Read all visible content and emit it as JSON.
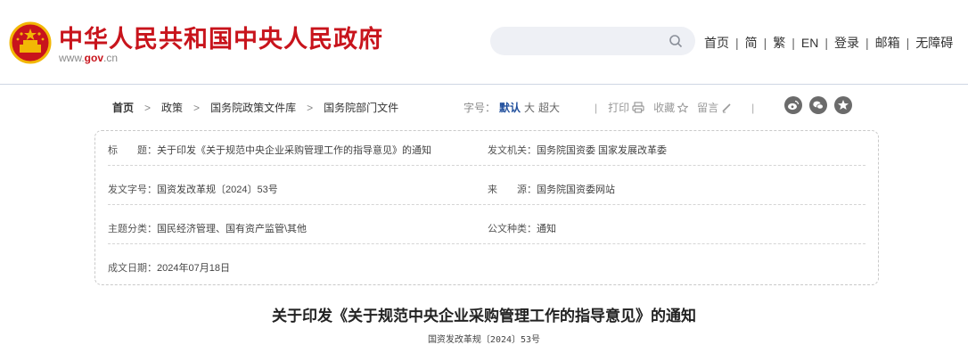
{
  "header": {
    "title": "中华人民共和国中央人民政府",
    "url_prefix": "www.",
    "url_gov": "gov",
    "url_suffix": ".cn",
    "search": {
      "placeholder": ""
    },
    "nav": [
      "首页",
      "简",
      "繁",
      "EN",
      "登录",
      "邮箱",
      "无障碍"
    ]
  },
  "breadcrumb": {
    "items": [
      "首页",
      "政策",
      "国务院政策文件库",
      "国务院部门文件"
    ],
    "separator": ">"
  },
  "font_size": {
    "label": "字号：",
    "options": [
      "默认",
      "大",
      "超大"
    ],
    "selected": "默认"
  },
  "tools": {
    "divider": "|",
    "print": "打印",
    "favorite": "收藏",
    "comment": "留言"
  },
  "info": {
    "title_label": "标　　题：",
    "title_value": "关于印发《关于规范中央企业采购管理工作的指导意见》的通知",
    "issuer_label": "发文机关：",
    "issuer_value": "国务院国资委  国家发展改革委",
    "doc_no_label": "发文字号：",
    "doc_no_value": "国资发改革规〔2024〕53号",
    "source_label": "来　　源：",
    "source_value": "国务院国资委网站",
    "topic_label": "主题分类：",
    "topic_value": "国民经济管理、国有资产监管\\其他",
    "type_label": "公文种类：",
    "type_value": "通知",
    "date_label": "成文日期：",
    "date_value": "2024年07月18日"
  },
  "document": {
    "title": "关于印发《关于规范中央企业采购管理工作的指导意见》的通知",
    "number": "国资发改革规〔2024〕53号"
  },
  "colors": {
    "brand_red": "#c8141c",
    "accent_blue": "#1f4e9c",
    "emblem_gold": "#f2b705"
  }
}
